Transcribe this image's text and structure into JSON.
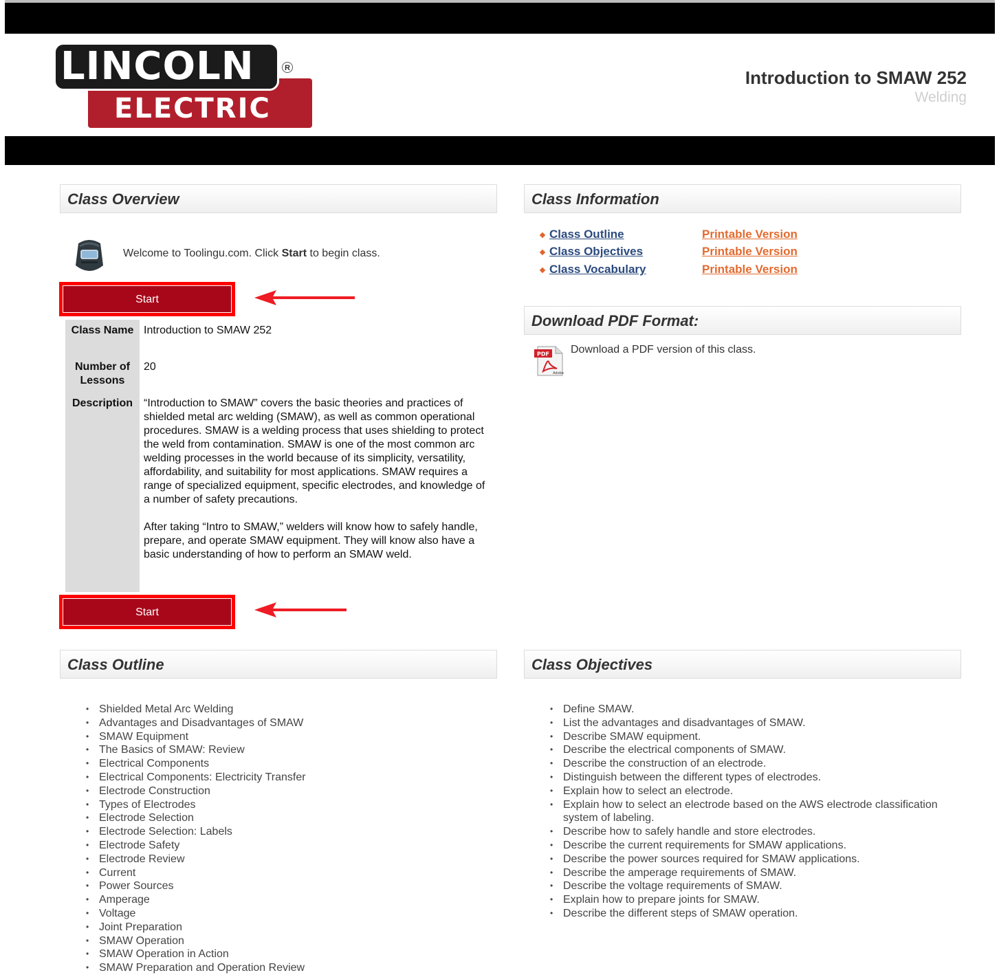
{
  "header": {
    "logo_top": "LINCOLN",
    "logo_bottom": "ELECTRIC",
    "logo_reg": "R",
    "class_title": "Introduction to SMAW 252",
    "class_category": "Welding"
  },
  "overview": {
    "heading": "Class Overview",
    "welcome_before": "Welcome to Toolingu.com. Click ",
    "welcome_bold": "Start",
    "welcome_after": " to begin class.",
    "start_label": "Start",
    "class_name_label": "Class Name",
    "class_name_value": "Introduction to SMAW 252",
    "lessons_label": "Number of Lessons",
    "lessons_value": "20",
    "description_label": "Description",
    "description_p1": "“Introduction to SMAW” covers the basic theories and practices of shielded metal arc welding (SMAW), as well as common operational procedures. SMAW is a welding process that uses shielding to protect the weld from contamination. SMAW is one of the most common arc welding processes in the world because of its simplicity, versatility, affordability, and suitability for most applications. SMAW requires a range of specialized equipment, specific electrodes, and knowledge of a number of safety precautions.",
    "description_p2": "After taking “Intro to SMAW,” welders will know how to safely handle, prepare, and operate SMAW equipment. They will know also have a basic understanding of how to perform an SMAW weld."
  },
  "information": {
    "heading": "Class Information",
    "links": [
      {
        "label": "Class Outline",
        "print": "Printable Version"
      },
      {
        "label": "Class Objectives",
        "print": "Printable Version"
      },
      {
        "label": "Class Vocabulary",
        "print": "Printable Version"
      }
    ]
  },
  "download": {
    "heading": "Download PDF Format:",
    "text": "Download a PDF version of this class.",
    "pdf_badge": "PDF",
    "adobe_text": "Adobe"
  },
  "outline": {
    "heading": "Class Outline",
    "items": [
      "Shielded Metal Arc Welding",
      "Advantages and Disadvantages of SMAW",
      "SMAW Equipment",
      "The Basics of SMAW: Review",
      "Electrical Components",
      "Electrical Components: Electricity Transfer",
      "Electrode Construction",
      "Types of Electrodes",
      "Electrode Selection",
      "Electrode Selection: Labels",
      "Electrode Safety",
      "Electrode Review",
      "Current",
      "Power Sources",
      "Amperage",
      "Voltage",
      "Joint Preparation",
      "SMAW Operation",
      "SMAW Operation in Action",
      "SMAW Preparation and Operation Review"
    ]
  },
  "objectives": {
    "heading": "Class Objectives",
    "items": [
      "Define SMAW.",
      "List the advantages and disadvantages of SMAW.",
      "Describe SMAW equipment.",
      "Describe the electrical components of SMAW.",
      "Describe the construction of an electrode.",
      "Distinguish between the different types of electrodes.",
      "Explain how to select an electrode.",
      "Explain how to select an electrode based on the AWS electrode classification system of labeling.",
      "Describe how to safely handle and store electrodes.",
      "Describe the current requirements for SMAW applications.",
      "Describe the power sources required for SMAW applications.",
      "Describe the amperage requirements of SMAW.",
      "Describe the voltage requirements of SMAW.",
      "Explain how to prepare joints for SMAW.",
      "Describe the different steps of SMAW operation."
    ]
  },
  "colors": {
    "start_button": "#a8071a",
    "highlight_box": "#ff0000",
    "link_blue": "#2b4a7e",
    "link_orange": "#e26b2f",
    "logo_red": "#b21f2c"
  }
}
